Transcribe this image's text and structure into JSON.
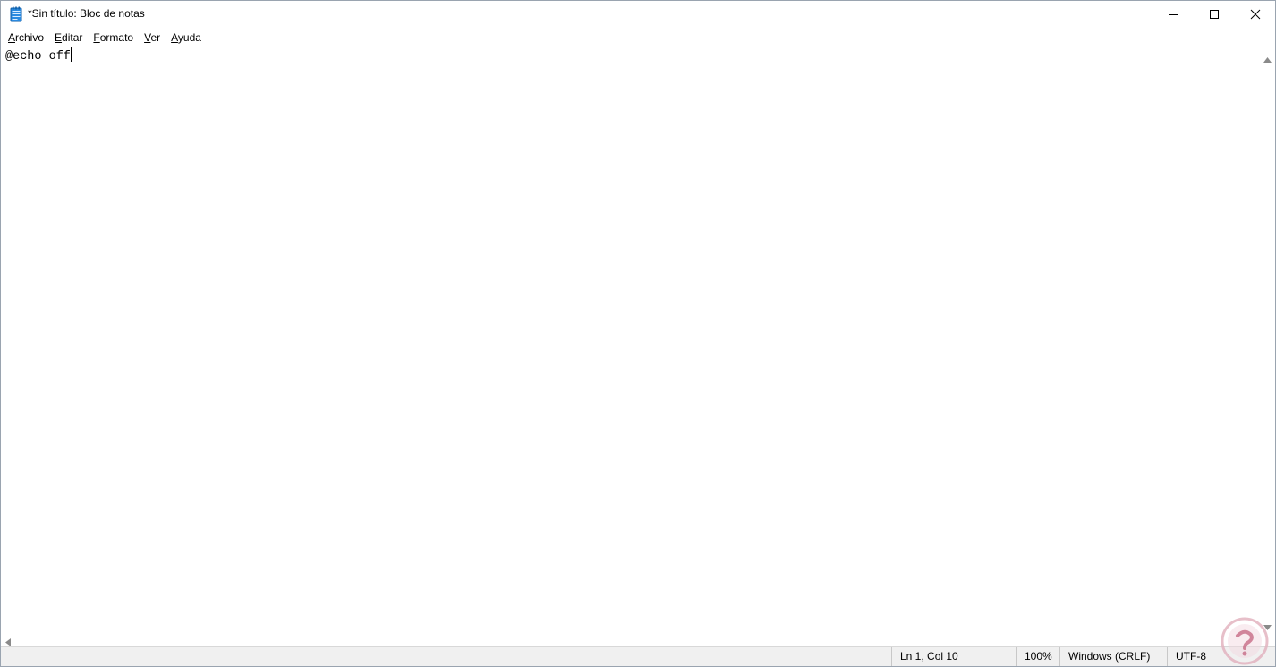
{
  "window": {
    "title": "*Sin título: Bloc de notas"
  },
  "menu": {
    "items": [
      {
        "label": "Archivo",
        "accel": "A",
        "rest": "rchivo"
      },
      {
        "label": "Editar",
        "accel": "E",
        "rest": "ditar"
      },
      {
        "label": "Formato",
        "accel": "F",
        "rest": "ormato"
      },
      {
        "label": "Ver",
        "accel": "V",
        "rest": "er"
      },
      {
        "label": "Ayuda",
        "accel": "A",
        "rest": "yuda"
      }
    ]
  },
  "editor": {
    "content": "@echo off"
  },
  "status": {
    "position": "Ln 1, Col 10",
    "zoom": "100%",
    "line_ending": "Windows (CRLF)",
    "encoding": "UTF-8"
  },
  "icons": {
    "app": "notepad-icon",
    "minimize": "minimize-icon",
    "maximize": "maximize-icon",
    "close": "close-icon",
    "watermark": "solvetic-logo-icon"
  },
  "colors": {
    "app_icon": "#1e7bd6",
    "statusbar_bg": "#f0f0f0",
    "watermark": "#e8a0b0"
  }
}
